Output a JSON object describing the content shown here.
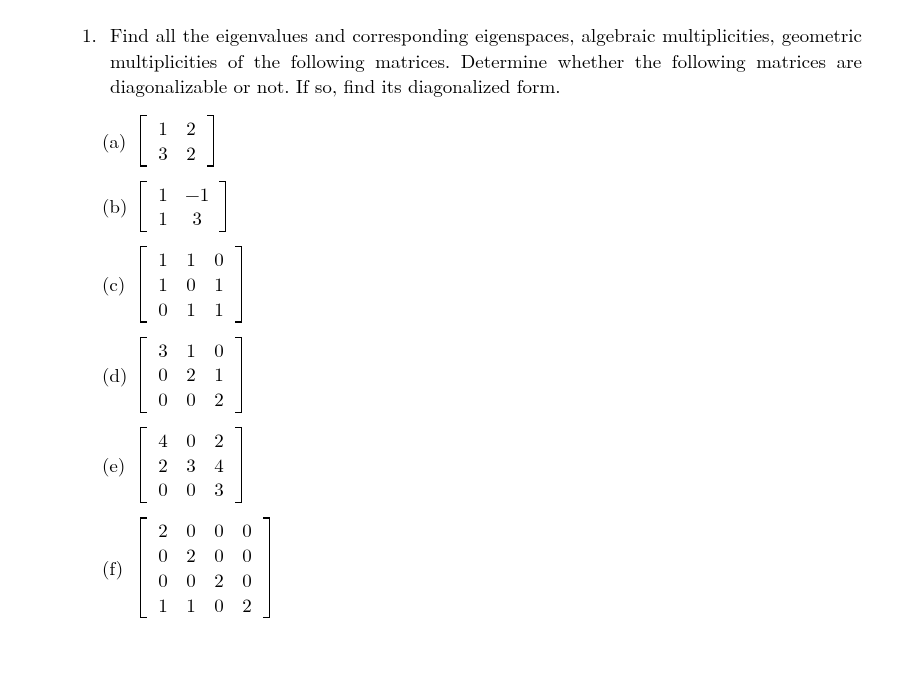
{
  "problem": {
    "number": "1.",
    "text": "Find all the eigenvalues and corresponding eigenspaces, algebraic multiplicities, geometric multiplicities of the following matrices. Determine whether the following matrices are diagonalizable or not. If so, find its diagonalized form."
  },
  "items": [
    {
      "label": "(a)",
      "rows": 2,
      "cols": 2,
      "cells": [
        "1",
        "2",
        "3",
        "2"
      ]
    },
    {
      "label": "(b)",
      "rows": 2,
      "cols": 2,
      "cells": [
        "1",
        "−1",
        "1",
        "3"
      ]
    },
    {
      "label": "(c)",
      "rows": 3,
      "cols": 3,
      "cells": [
        "1",
        "1",
        "0",
        "1",
        "0",
        "1",
        "0",
        "1",
        "1"
      ]
    },
    {
      "label": "(d)",
      "rows": 3,
      "cols": 3,
      "cells": [
        "3",
        "1",
        "0",
        "0",
        "2",
        "1",
        "0",
        "0",
        "2"
      ]
    },
    {
      "label": "(e)",
      "rows": 3,
      "cols": 3,
      "cells": [
        "4",
        "0",
        "2",
        "2",
        "3",
        "4",
        "0",
        "0",
        "3"
      ]
    },
    {
      "label": "(f)",
      "rows": 4,
      "cols": 4,
      "cells": [
        "2",
        "0",
        "0",
        "0",
        "0",
        "2",
        "0",
        "0",
        "0",
        "0",
        "2",
        "0",
        "1",
        "1",
        "0",
        "2"
      ]
    }
  ]
}
